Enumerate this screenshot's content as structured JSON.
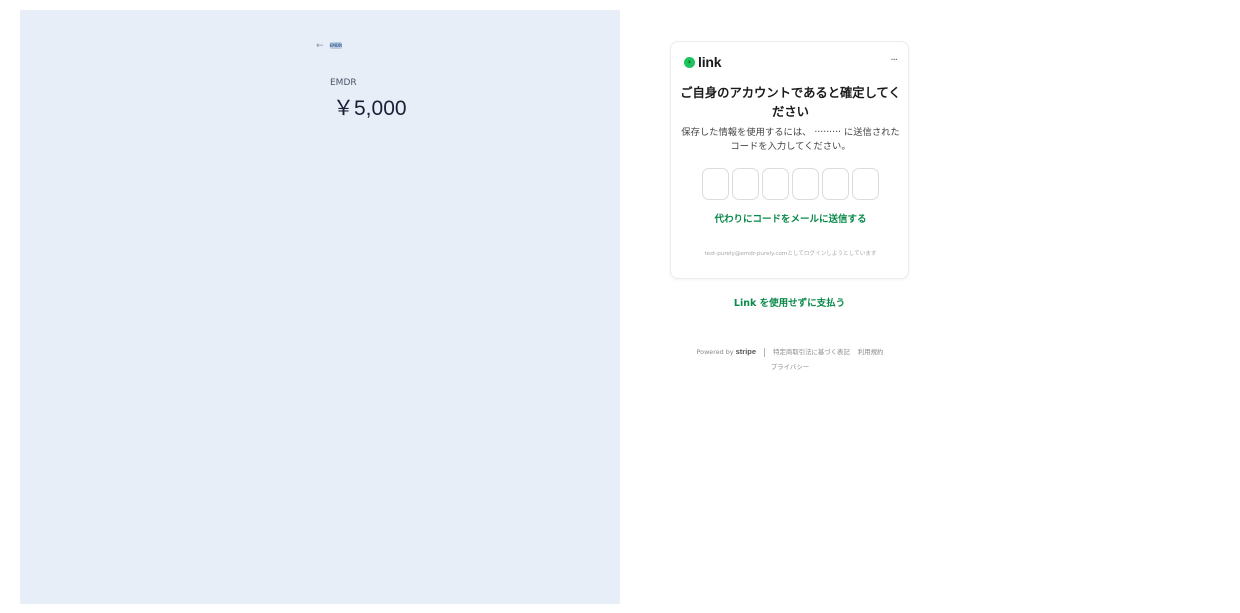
{
  "summary": {
    "back_arrow": "←",
    "merchant_logo_text": "EMDR",
    "product_name": "EMDR",
    "price": "￥5,000"
  },
  "link_card": {
    "brand_mark": "›",
    "brand": "link",
    "menu": "···",
    "title": "ご自身のアカウントであると確定してください",
    "description": "保存した情報を使用するには、 ·········  に送信されたコードを入力してください。",
    "code_digits": [
      "",
      "",
      "",
      "",
      "",
      ""
    ],
    "email_code_link": "代わりにコードをメールに送信する",
    "logging_in_as": "test-purely@emdr-purely.comとしてログインしようとしています"
  },
  "pay_without_link": "Link を使用せずに支払う",
  "footer": {
    "powered_by": "Powered by",
    "stripe": "stripe",
    "commerce_law": "特定商取引法に基づく表記",
    "terms": "利用規約",
    "privacy": "プライバシー"
  },
  "colors": {
    "left_panel_bg": "#e7eef8",
    "link_green": "#1dc35d",
    "link_text_green": "#0a8a4a"
  }
}
